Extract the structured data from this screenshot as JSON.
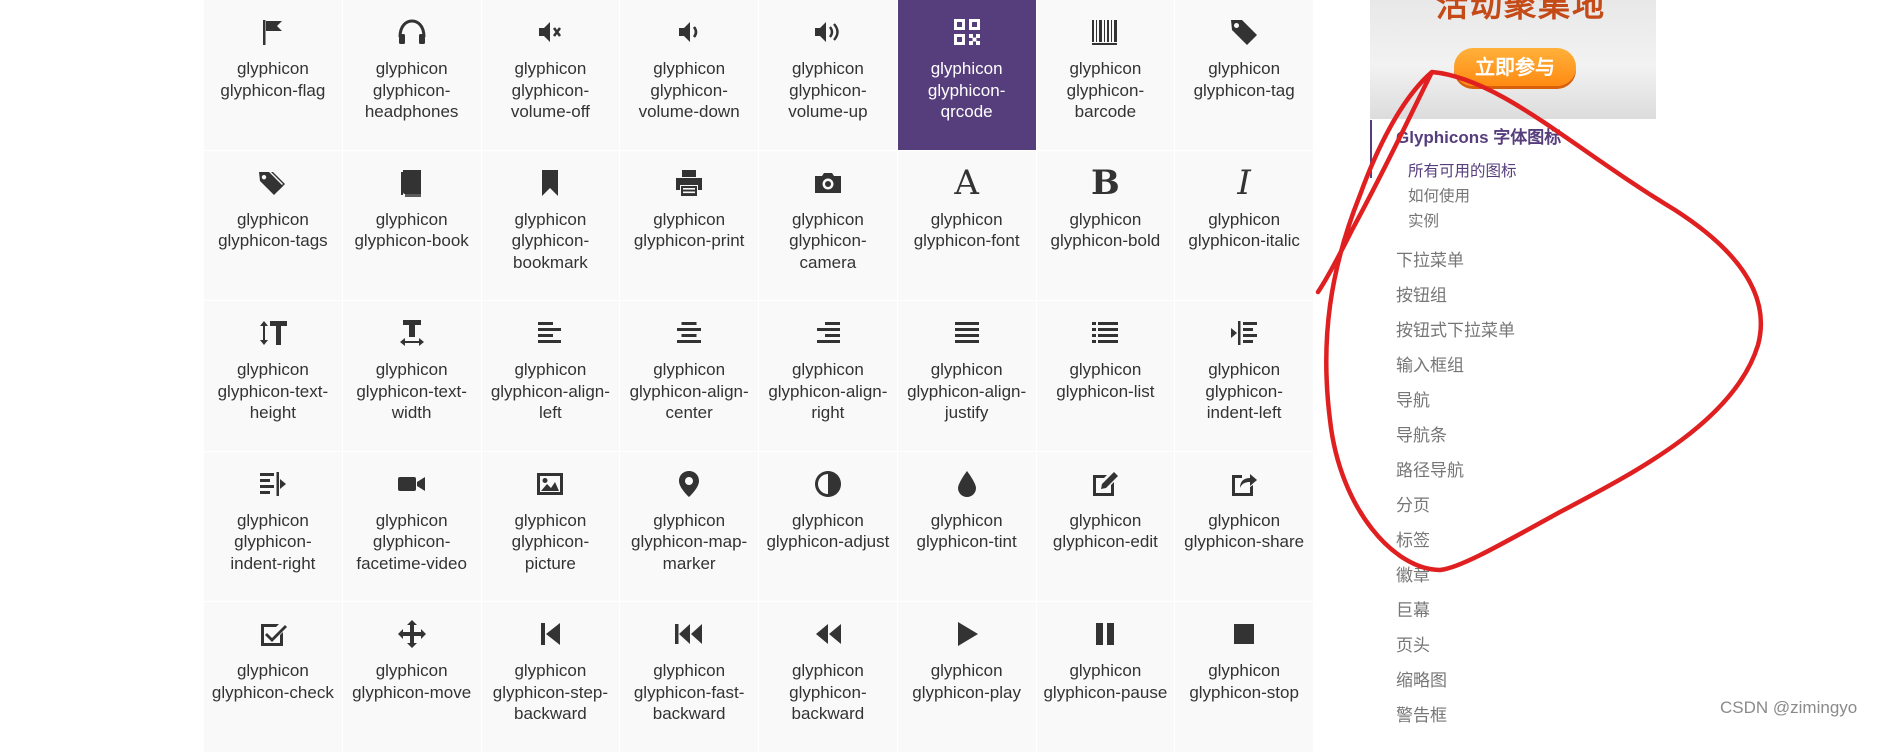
{
  "grid": {
    "items": [
      {
        "icon": "flag-icon",
        "label": "glyphicon glyphicon-flag",
        "active": false
      },
      {
        "icon": "headphones-icon",
        "label": "glyphicon glyphicon-headphones",
        "active": false
      },
      {
        "icon": "volume-off-icon",
        "label": "glyphicon glyphicon-volume-off",
        "active": false
      },
      {
        "icon": "volume-down-icon",
        "label": "glyphicon glyphicon-volume-down",
        "active": false
      },
      {
        "icon": "volume-up-icon",
        "label": "glyphicon glyphicon-volume-up",
        "active": false
      },
      {
        "icon": "qrcode-icon",
        "label": "glyphicon glyphicon-qrcode",
        "active": true
      },
      {
        "icon": "barcode-icon",
        "label": "glyphicon glyphicon-barcode",
        "active": false
      },
      {
        "icon": "tag-icon",
        "label": "glyphicon glyphicon-tag",
        "active": false
      },
      {
        "icon": "tags-icon",
        "label": "glyphicon glyphicon-tags",
        "active": false
      },
      {
        "icon": "book-icon",
        "label": "glyphicon glyphicon-book",
        "active": false
      },
      {
        "icon": "bookmark-icon",
        "label": "glyphicon glyphicon-bookmark",
        "active": false
      },
      {
        "icon": "print-icon",
        "label": "glyphicon glyphicon-print",
        "active": false
      },
      {
        "icon": "camera-icon",
        "label": "glyphicon glyphicon-camera",
        "active": false
      },
      {
        "icon": "font-icon",
        "label": "glyphicon glyphicon-font",
        "active": false,
        "glyph": "A"
      },
      {
        "icon": "bold-icon",
        "label": "glyphicon glyphicon-bold",
        "active": false,
        "glyph": "B"
      },
      {
        "icon": "italic-icon",
        "label": "glyphicon glyphicon-italic",
        "active": false,
        "glyph": "I"
      },
      {
        "icon": "text-height-icon",
        "label": "glyphicon glyphicon-text-height",
        "active": false
      },
      {
        "icon": "text-width-icon",
        "label": "glyphicon glyphicon-text-width",
        "active": false
      },
      {
        "icon": "align-left-icon",
        "label": "glyphicon glyphicon-align-left",
        "active": false
      },
      {
        "icon": "align-center-icon",
        "label": "glyphicon glyphicon-align-center",
        "active": false
      },
      {
        "icon": "align-right-icon",
        "label": "glyphicon glyphicon-align-right",
        "active": false
      },
      {
        "icon": "align-justify-icon",
        "label": "glyphicon glyphicon-align-justify",
        "active": false
      },
      {
        "icon": "list-icon",
        "label": "glyphicon glyphicon-list",
        "active": false
      },
      {
        "icon": "indent-left-icon",
        "label": "glyphicon glyphicon-indent-left",
        "active": false
      },
      {
        "icon": "indent-right-icon",
        "label": "glyphicon glyphicon-indent-right",
        "active": false
      },
      {
        "icon": "facetime-video-icon",
        "label": "glyphicon glyphicon-facetime-video",
        "active": false
      },
      {
        "icon": "picture-icon",
        "label": "glyphicon glyphicon-picture",
        "active": false
      },
      {
        "icon": "map-marker-icon",
        "label": "glyphicon glyphicon-map-marker",
        "active": false
      },
      {
        "icon": "adjust-icon",
        "label": "glyphicon glyphicon-adjust",
        "active": false
      },
      {
        "icon": "tint-icon",
        "label": "glyphicon glyphicon-tint",
        "active": false
      },
      {
        "icon": "edit-icon",
        "label": "glyphicon glyphicon-edit",
        "active": false
      },
      {
        "icon": "share-icon",
        "label": "glyphicon glyphicon-share",
        "active": false
      },
      {
        "icon": "check-icon",
        "label": "glyphicon glyphicon-check",
        "active": false
      },
      {
        "icon": "move-icon",
        "label": "glyphicon glyphicon-move",
        "active": false
      },
      {
        "icon": "step-backward-icon",
        "label": "glyphicon glyphicon-step-backward",
        "active": false
      },
      {
        "icon": "fast-backward-icon",
        "label": "glyphicon glyphicon-fast-backward",
        "active": false
      },
      {
        "icon": "backward-icon",
        "label": "glyphicon glyphicon-backward",
        "active": false
      },
      {
        "icon": "play-icon",
        "label": "glyphicon glyphicon-play",
        "active": false
      },
      {
        "icon": "pause-icon",
        "label": "glyphicon glyphicon-pause",
        "active": false
      },
      {
        "icon": "stop-icon",
        "label": "glyphicon glyphicon-stop",
        "active": false
      }
    ]
  },
  "ad": {
    "title": "活动聚集地",
    "button_label": "立即参与"
  },
  "sidebar": {
    "active_section": "Glyphicons 字体图标",
    "sub_items": [
      {
        "label": "所有可用的图标",
        "active": true
      },
      {
        "label": "如何使用",
        "active": false
      },
      {
        "label": "实例",
        "active": false
      }
    ],
    "items": [
      "下拉菜单",
      "按钮组",
      "按钮式下拉菜单",
      "输入框组",
      "导航",
      "导航条",
      "路径导航",
      "分页",
      "标签",
      "徽章",
      "巨幕",
      "页头",
      "缩略图",
      "警告框"
    ]
  },
  "watermark": "CSDN @zimingyo",
  "colors": {
    "accent": "#563d7c",
    "annotation": "#e02020",
    "cell_background": "#f9f9f9",
    "muted_text": "#767676"
  }
}
